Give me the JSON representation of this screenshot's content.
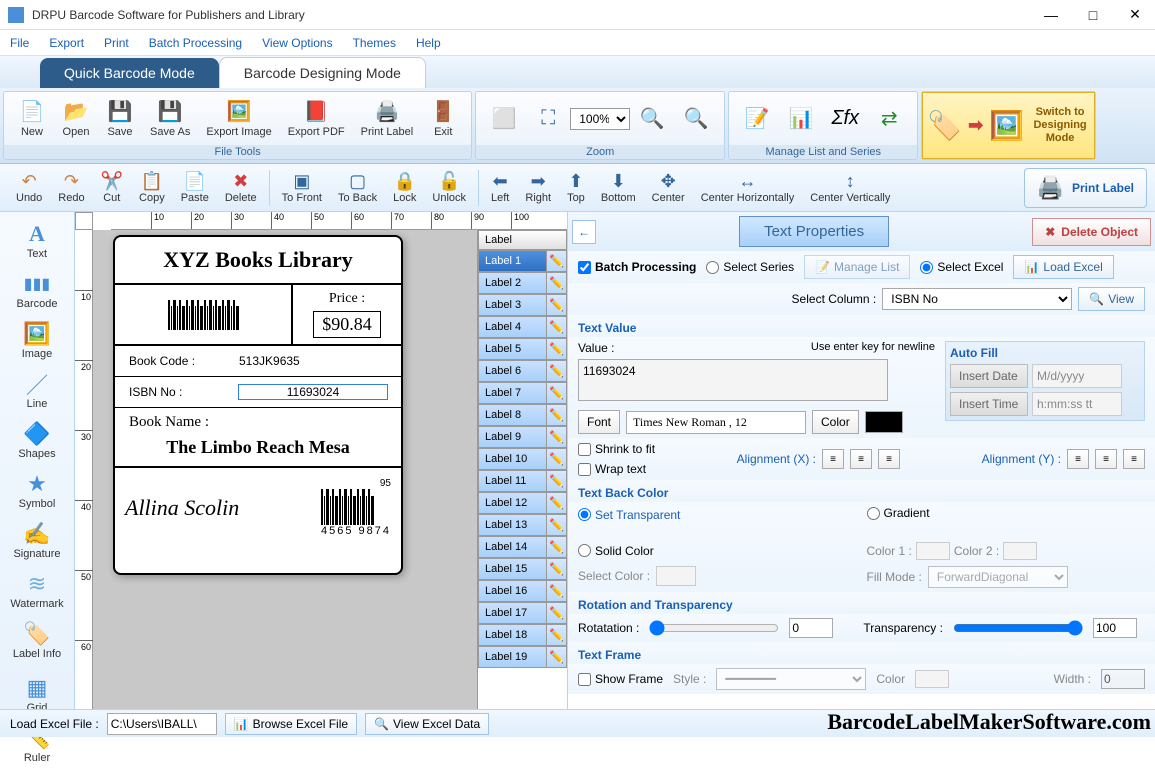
{
  "title": "DRPU Barcode Software for Publishers and Library",
  "menubar": [
    "File",
    "Export",
    "Print",
    "Batch Processing",
    "View Options",
    "Themes",
    "Help"
  ],
  "modeTabs": {
    "active": "Quick Barcode Mode",
    "inactive": "Barcode Designing Mode"
  },
  "ribbon": {
    "fileTools": {
      "label": "File Tools",
      "items": [
        "New",
        "Open",
        "Save",
        "Save As",
        "Export Image",
        "Export PDF",
        "Print Label",
        "Exit"
      ]
    },
    "zoom": {
      "label": "Zoom",
      "value": "100%"
    },
    "manage": {
      "label": "Manage List and Series"
    },
    "switch": "Switch to Designing Mode"
  },
  "toolbar2": [
    "Undo",
    "Redo",
    "Cut",
    "Copy",
    "Paste",
    "Delete",
    "To Front",
    "To Back",
    "Lock",
    "Unlock",
    "Left",
    "Right",
    "Top",
    "Bottom",
    "Center",
    "Center Horizontally",
    "Center Vertically"
  ],
  "printLabel": "Print Label",
  "leftTools": [
    "Text",
    "Barcode",
    "Image",
    "Line",
    "Shapes",
    "Symbol",
    "Signature",
    "Watermark",
    "Label Info",
    "Grid",
    "Ruler"
  ],
  "rulerH": [
    "10",
    "20",
    "30",
    "40",
    "50",
    "60",
    "70",
    "80",
    "90",
    "100"
  ],
  "rulerV": [
    "10",
    "20",
    "30",
    "40",
    "50",
    "60"
  ],
  "labelCard": {
    "title": "XYZ Books Library",
    "priceLabel": "Price :",
    "price": "$90.84",
    "bookCodeLabel": "Book Code :",
    "bookCode": "513JK9635",
    "isbnLabel": "ISBN No :",
    "isbn": "11693024",
    "bookNameLabel": "Book Name :",
    "bookName": "The Limbo Reach Mesa",
    "signature": "Allina Scolin",
    "barcode2top": "95",
    "barcode2bottom": "4565  9874"
  },
  "labelList": {
    "header": "Label",
    "items": [
      "Label 1",
      "Label 2",
      "Label 3",
      "Label 4",
      "Label 5",
      "Label 6",
      "Label 7",
      "Label 8",
      "Label 9",
      "Label 10",
      "Label 11",
      "Label 12",
      "Label 13",
      "Label 14",
      "Label 15",
      "Label 16",
      "Label 17",
      "Label 18",
      "Label 19"
    ],
    "selected": 0
  },
  "rightPanel": {
    "title": "Text Properties",
    "delete": "Delete Object",
    "batchProcessing": "Batch Processing",
    "selectSeries": "Select Series",
    "manageList": "Manage List",
    "selectExcel": "Select Excel",
    "loadExcel": "Load Excel",
    "selectColumn": "Select Column :",
    "columnValue": "ISBN No",
    "view": "View",
    "textValue": "Text Value",
    "valueLabel": "Value :",
    "enterHint": "Use enter key for newline",
    "value": "11693024",
    "font": "Font",
    "fontValue": "Times New Roman , 12",
    "color": "Color",
    "autoFill": "Auto Fill",
    "insertDate": "Insert Date",
    "dateFmt": "M/d/yyyy",
    "insertTime": "Insert Time",
    "timeFmt": "h:mm:ss tt",
    "shrink": "Shrink to fit",
    "wrap": "Wrap text",
    "alignX": "Alignment (X)  :",
    "alignY": "Alignment (Y)  :",
    "textBackColor": "Text Back Color",
    "setTransparent": "Set Transparent",
    "gradient": "Gradient",
    "solidColor": "Solid Color",
    "selectColor": "Select Color :",
    "color1": "Color 1 :",
    "color2": "Color 2 :",
    "fillMode": "Fill Mode :",
    "fillModeVal": "ForwardDiagonal",
    "rotation": "Rotation and Transparency",
    "rotatation": "Rotatation  :",
    "rotVal": "0",
    "transparency": "Transparency  :",
    "transVal": "100",
    "textFrame": "Text Frame",
    "showFrame": "Show Frame",
    "style": "Style  :",
    "widthL": "Width :",
    "widthVal": "0"
  },
  "bottom": {
    "loadExcel": "Load Excel File :",
    "path": "C:\\Users\\IBALL\\",
    "browse": "Browse Excel File",
    "viewData": "View Excel Data"
  },
  "watermark": "BarcodeLabelMakerSoftware.com"
}
